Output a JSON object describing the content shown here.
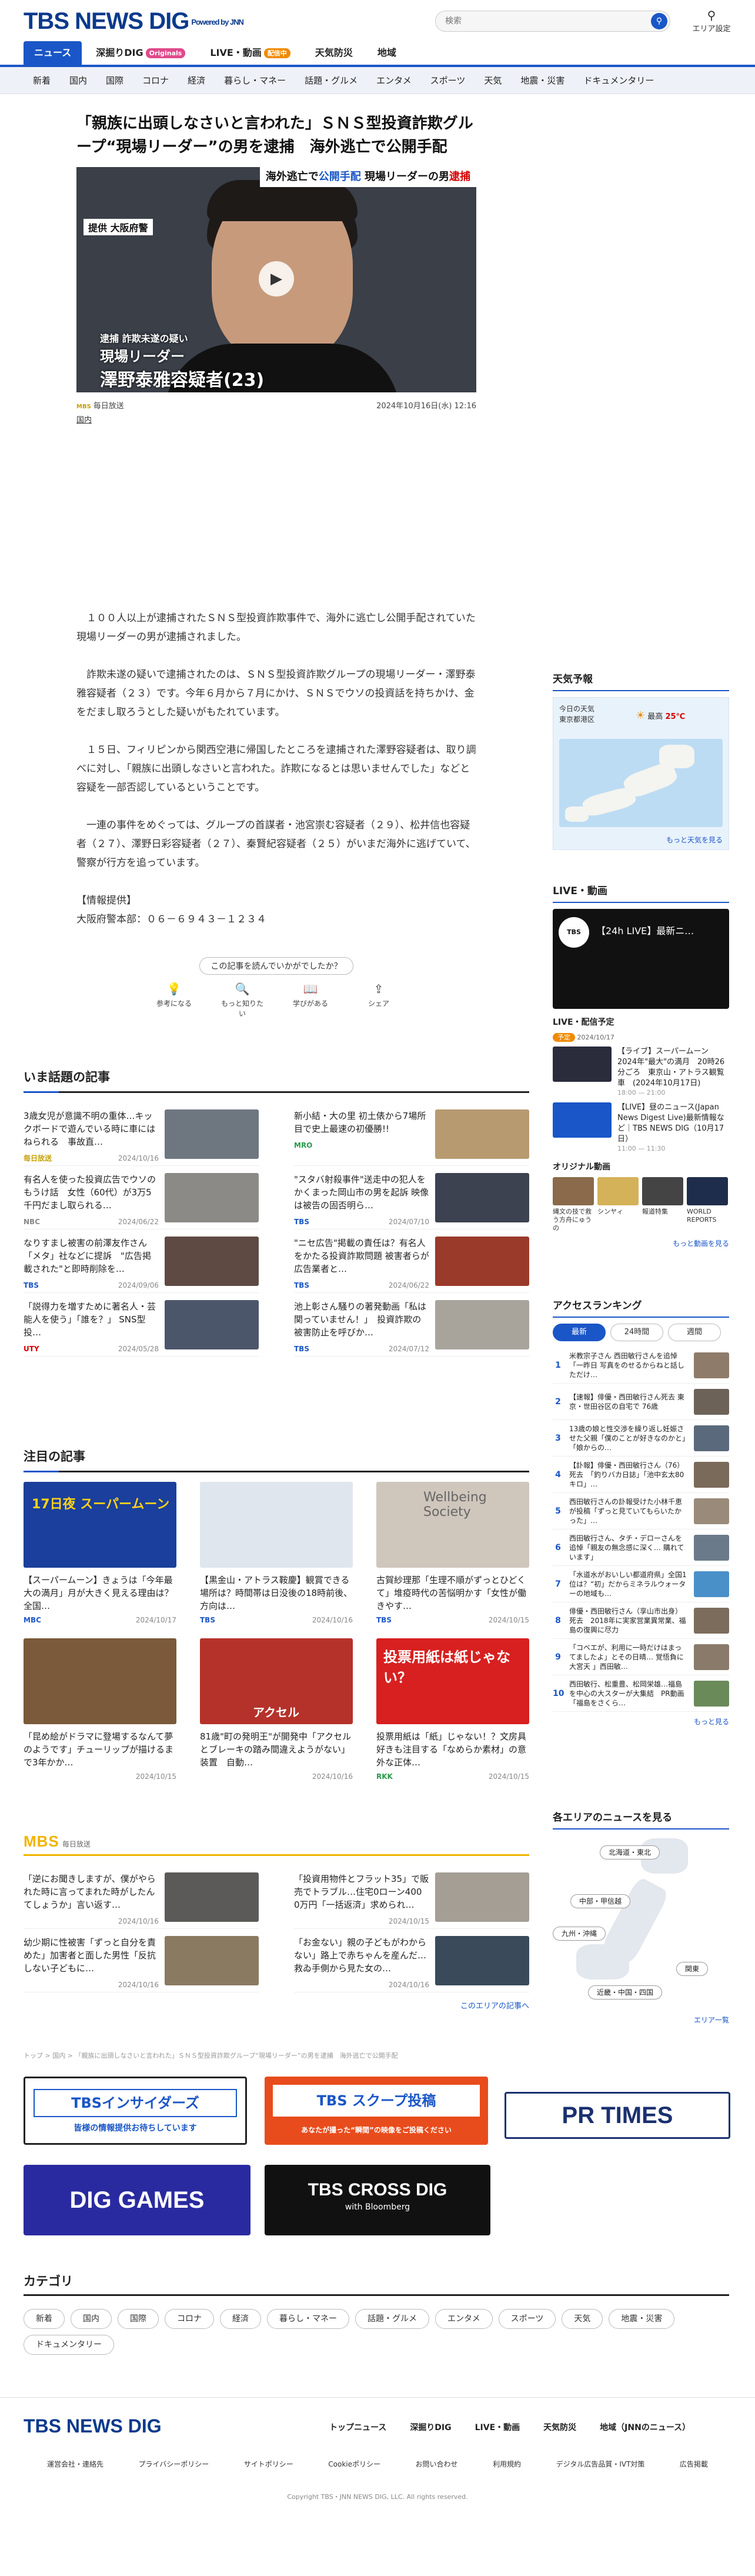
{
  "header": {
    "logo": "TBS NEWS DIG",
    "logo_sub": "Powered by JNN",
    "search_placeholder": "検索",
    "area_label": "エリア設定",
    "nav": [
      {
        "label": "ニュース",
        "badge": ""
      },
      {
        "label": "深掘りDIG",
        "badge": "Originals"
      },
      {
        "label": "LIVE・動画",
        "badge": "配信中"
      },
      {
        "label": "天気防災",
        "badge": ""
      },
      {
        "label": "地域",
        "badge": ""
      }
    ],
    "subnav": [
      "新着",
      "国内",
      "国際",
      "コロナ",
      "経済",
      "暮らし・マネー",
      "話題・グルメ",
      "エンタメ",
      "スポーツ",
      "天気",
      "地震・災害",
      "ドキュメンタリー"
    ]
  },
  "article": {
    "title": "「親族に出頭しなさいと言われた」ＳＮＳ型投資詐欺グループ“現場リーダー”の男を逮捕　海外逃亡で公開手配",
    "hero": {
      "top_plain": "海外逃亡で",
      "top_blue": "公開手配",
      "top_mid": "現場リーダーの男",
      "top_red": "逮捕",
      "source": "提供 大阪府警",
      "cap1": "逮捕 詐欺未遂の疑い",
      "cap2": "現場リーダー",
      "cap3": "澤野泰雅容疑者(23)"
    },
    "source": "毎日放送",
    "source_tag": "MBS",
    "date": "2024年10月16日(水) 12:16",
    "category": "国内",
    "paragraphs": [
      "　１００人以上が逮捕されたＳＮＳ型投資詐欺事件で、海外に逃亡し公開手配されていた現場リーダーの男が逮捕されました。",
      "　詐欺未遂の疑いで逮捕されたのは、ＳＮＳ型投資詐欺グループの現場リーダー・澤野泰雅容疑者（２３）です。今年６月から７月にかけ、ＳＮＳでウソの投資話を持ちかけ、金をだまし取ろうとした疑いがもたれています。",
      "　１５日、フィリピンから関西空港に帰国したところを逮捕された澤野容疑者は、取り調べに対し、「親族に出頭しなさいと言われた。詐欺になるとは思いませんでした」などと容疑を一部否認しているということです。",
      "　一連の事件をめぐっては、グループの首謀者・池宮崇む容疑者（２９）、松井信也容疑者（２７）、澤野日彩容疑者（２７）、秦賢紀容疑者（２５）がいまだ海外に逃げていて、警察が行方を追っています。"
    ],
    "info_title": "【情報提供】",
    "info_body": "大阪府警本部：０６－６９４３－１２３４",
    "feedback_q": "この記事を読んでいかがでしたか？",
    "feedback": [
      {
        "icon": "lightbulb-icon",
        "glyph": "💡",
        "label": "参考になる"
      },
      {
        "icon": "magnifier-icon",
        "glyph": "🔍",
        "label": "もっと知りたい"
      },
      {
        "icon": "book-icon",
        "glyph": "📖",
        "label": "学びがある"
      },
      {
        "icon": "share-icon",
        "glyph": "⇪",
        "label": "シェア"
      }
    ]
  },
  "weather": {
    "title": "天気予報",
    "today": "今日の天気",
    "place": "東京都港区",
    "high_label": "最高",
    "high": "25℃",
    "more": "もっと天気を見る"
  },
  "live": {
    "title": "LIVE・動画",
    "box_title": "【24h LIVE】最新ニ…",
    "box_logo": "TBS LIVE",
    "sched_title": "LIVE・配信予定",
    "sched_badge": "予定",
    "sched_date": "2024/10/17",
    "items": [
      {
        "title": "【ライブ】スーパームーン 2024年\"最大\"の満月　20時26分ごろ　東京山・アトラス観覧車　(2024年10月17日)",
        "time": "18:00 — 21:00"
      },
      {
        "title": "【LIVE】昼のニュース(Japan News Digest Live)最新情報など｜TBS NEWS DIG（10月17日）",
        "time": "11:00 — 11:30"
      }
    ],
    "orig_title": "オリジナル動画",
    "originals": [
      {
        "label": "縄文の技で救う方舟にゅうの"
      },
      {
        "label": "シンヤィ"
      },
      {
        "label": "報道特集"
      },
      {
        "label": "WORLD REPORTS"
      }
    ],
    "more": "もっと動画を見る"
  },
  "ranking": {
    "title": "アクセスランキング",
    "tabs": [
      "最新",
      "24時間",
      "週間"
    ],
    "items": [
      "米教宗子さん 西田敏行さんを追悼「一昨日 写真をのせるからねと話しただけ…",
      "【速報】俳優・西田敏行さん死去 東京・世田谷区の自宅で 76歳",
      "13歳の娘と性交渉を繰り返し妊娠させた父親「僕のことが好きなのかと」「娘からの…",
      "【訃報】俳優・西田敏行さん（76）死去　「釣りバカ日誌」「池中玄太80キロ」…",
      "西田敏行さんの訃報受けた小林千恵が投稿「ずっと見ていてもらいたかった」…",
      "西田敏行さん、タチ・デローさんを追悼「親友の無念感に深く… 購れています」",
      "「水道水がおいしい都道府県」全国1位は？“初」だからミネラルウォーターの地域も…",
      "俳優・西田敏行さん（享山市出身）死去　2018年に実家営業異常業、福島の復興に尽力",
      "「コベエが、利用に一時だけはまってましたよ」とその日晴… 覚悟負に大宮天 」西田敏…",
      "西田敏行、松重豊、松岡栄雄…福島を中心の大スターが大集結　PR動画「福島をさくら…"
    ],
    "more": "もっと見る"
  },
  "area_news": {
    "title": "各エリアのニュースを見る",
    "buttons": [
      "北海道・東北",
      "中部・甲信越",
      "九州・沖縄",
      "関東",
      "近畿・中国・四国"
    ],
    "more": "エリア一覧"
  },
  "trending": {
    "title": "いま話題の記事",
    "items": [
      {
        "title": "3歳女児が意識不明の重体…キックボードで遊んでいる時に車にはねられる　事故直…",
        "src": "毎日放送",
        "date": "2024/10/16"
      },
      {
        "title": "新小結・大の里 初土俵から7場所目で史上最速の初優勝!!",
        "src": "MRO",
        "date": "2024/05/26"
      },
      {
        "title": "有名人を使った投資広告でウソのもうけ話　女性（60代）が3万5千円だまし取られる…",
        "src": "NBC",
        "date": "2024/06/22"
      },
      {
        "title": "\"スタバ射殺事件\"送走中の犯人をかくまった岡山市の男を起訴 映像は被告の固否明ら…",
        "src": "TBS",
        "date": "2024/07/10"
      },
      {
        "title": "なりすまし被害の前澤友作さん「メタ」社などに提訴　\"広告掲載された\"と即時削除を…",
        "src": "TBS",
        "date": "2024/09/06"
      },
      {
        "title": "\"ニセ広告\"掲載の責任は？有名人をかたる投資詐欺問題 被害者らが広告業者と…",
        "src": "TBS",
        "date": "2024/06/22"
      },
      {
        "title": "「説得力を増すために著名人・芸能人を使う」「誰を？」 SNS型投…",
        "src": "UTY",
        "date": "2024/05/28"
      },
      {
        "title": "池上彰さん騒りの著発動画「私は関っていません！」　投資詐欺の被害防止を呼びか…",
        "src": "TBS",
        "date": "2024/07/12"
      }
    ]
  },
  "featured": {
    "title": "注目の記事",
    "items": [
      {
        "title": "【スーパームーン】きょうは「今年最大の満月」月が大きく見える理由は？ 全国…",
        "src": "MBC",
        "date": "2024/10/17",
        "thumb_text": "17日夜 スーパームーン"
      },
      {
        "title": "【黒金山・アトラス鞍慶】観賞できる場所は？時間帯は日没後の18時前後、方向は…",
        "src": "TBS",
        "date": "2024/10/16",
        "thumb_text": ""
      },
      {
        "title": "古賀紗理那「生理不順がずっとひどくて」堆疫時代の苦悩明かす「女性が働きやす…",
        "src": "TBS",
        "date": "2024/10/15",
        "thumb_text": "Wellbeing Society"
      },
      {
        "title": "「昆め絵がドラマに登場するなんて夢のようです」チューリップが描けるまで3年かか…",
        "src": "",
        "date": "2024/10/15",
        "thumb_text": ""
      },
      {
        "title": "81歳\"町の発明王\"が開発中「アクセルとブレーキの踏み間違えようがない」装置　自動…",
        "src": "",
        "date": "2024/10/16",
        "thumb_text": "アクセル"
      },
      {
        "title": "投票用紙は「紙」じゃない！？文房具好きも注目する「なめらか素材」の意外な正体…",
        "src": "RKK",
        "date": "2024/10/15",
        "thumb_text": "投票用紙は紙じゃない？"
      }
    ]
  },
  "mbs": {
    "logo": "MBS",
    "label": "毎日放送",
    "items": [
      {
        "title": "「逆にお聞きしますが、僕がやられた時に言ってまれた時がしたんてしょうか」言い返す…",
        "date": "2024/10/16"
      },
      {
        "title": "「投資用物件とフラット35」で販売でトラブル…住宅0ローン400 0万円「一括返済」求められ…",
        "date": "2024/10/15"
      },
      {
        "title": "幼少期に性被害「ずっと自分を責めた」加害者と面した男性「反抗しない子どもに…",
        "date": "2024/10/16"
      },
      {
        "title": "「お金ない」親の子どもがわからない」路上で赤ちゃんを産んだ…　救ゐ手側から見た女の…",
        "date": "2024/10/16"
      }
    ],
    "more": "このエリアの記事へ"
  },
  "breadcrumb": "トップ > 国内 > 「親族に出頭しなさいと言われた」ＳＮＳ型投資詐欺グループ“現場リーダー”の男を逮捕　海外逃亡で公開手配",
  "banners": {
    "insider": "TBSインサイダーズ",
    "insider_sub": "皆様の情報提供お待ちしています",
    "scoop": "TBS スクープ投稿",
    "scoop_sub": "あなたが撮った“瞬間”の映像をご投稿ください",
    "prtimes": "PR TIMES",
    "diggames": "DIG GAMES",
    "crossdig": "TBS CROSS DIG",
    "crossdig_sub": "with Bloomberg"
  },
  "categories": {
    "title": "カテゴリ",
    "items": [
      "新着",
      "国内",
      "国際",
      "コロナ",
      "経済",
      "暮らし・マネー",
      "話題・グルメ",
      "エンタメ",
      "スポーツ",
      "天気",
      "地震・災害",
      "ドキュメンタリー"
    ]
  },
  "footer": {
    "logo": "TBS NEWS DIG",
    "nav": [
      "トップニュース",
      "深掘りDIG",
      "LIVE・動画",
      "天気防災",
      "地域（JNNのニュース）"
    ],
    "links": [
      "運営会社・連絡先",
      "プライバシーポリシー",
      "サイトポリシー",
      "Cookieポリシー",
      "お問い合わせ",
      "利用規約",
      "デジタル広告品質・IVT対策",
      "広告掲載"
    ],
    "copyright": "Copyright TBS・JNN NEWS DIG, LLC. All rights reserved."
  },
  "colors": {
    "brand": "#0a3a8c",
    "accent": "#1a56c7",
    "live": "#f08a00",
    "alert": "#d60000"
  }
}
